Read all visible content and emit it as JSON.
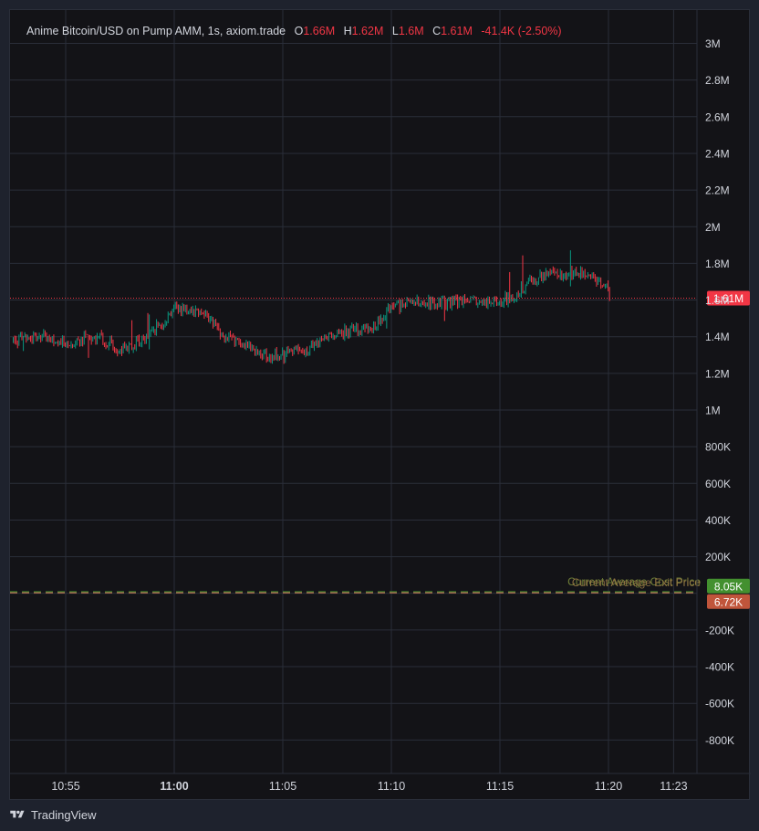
{
  "legend": {
    "symbol": "Anime Bitcoin/USD on Pump AMM, 1s, axiom.trade",
    "open_label": "O",
    "open": "1.66M",
    "high_label": "H",
    "high": "1.62M",
    "low_label": "L",
    "low": "1.6M",
    "close_label": "C",
    "close": "1.61M",
    "change": "-41.4K (-2.50%)"
  },
  "footer": {
    "brand": "TradingView"
  },
  "colors": {
    "background": "#131317",
    "grid": "#2a2e39",
    "text": "#d1d4dc",
    "up": "#089981",
    "down": "#f23645",
    "avg_green": "#43902f",
    "avg_red": "#c0553b"
  },
  "chart_data": {
    "type": "candlestick",
    "y_ticks": [
      "3M",
      "2.8M",
      "2.6M",
      "2.4M",
      "2.2M",
      "2M",
      "1.8M",
      "1.6M",
      "1.4M",
      "1.2M",
      "1M",
      "800K",
      "600K",
      "400K",
      "200K",
      "-200K",
      "-400K",
      "-600K",
      "-800K"
    ],
    "x_ticks": [
      {
        "label": "10:55",
        "time": "10:55",
        "bold": false
      },
      {
        "label": "11:00",
        "time": "11:00",
        "bold": true
      },
      {
        "label": "11:05",
        "time": "11:05",
        "bold": false
      },
      {
        "label": "11:10",
        "time": "11:10",
        "bold": false
      },
      {
        "label": "11:15",
        "time": "11:15",
        "bold": false
      },
      {
        "label": "11:20",
        "time": "11:20",
        "bold": false
      },
      {
        "label": "11:23",
        "time": "11:23",
        "bold": false
      }
    ],
    "ylim": [
      -850000,
      3050000
    ],
    "price_path": [
      [
        "10:52:35",
        1.38
      ],
      [
        "10:54:00",
        1.4
      ],
      [
        "10:55:00",
        1.37
      ],
      [
        "10:56:30",
        1.4
      ],
      [
        "10:57:30",
        1.33
      ],
      [
        "10:58:30",
        1.38
      ],
      [
        "10:59:30",
        1.48
      ],
      [
        "11:00:00",
        1.56
      ],
      [
        "11:00:40",
        1.55
      ],
      [
        "11:01:20",
        1.54
      ],
      [
        "11:02:00",
        1.43
      ],
      [
        "11:03:00",
        1.36
      ],
      [
        "11:04:00",
        1.3
      ],
      [
        "11:05:00",
        1.3
      ],
      [
        "11:06:00",
        1.33
      ],
      [
        "11:07:00",
        1.4
      ],
      [
        "11:08:00",
        1.43
      ],
      [
        "11:09:00",
        1.44
      ],
      [
        "11:10:00",
        1.56
      ],
      [
        "11:11:00",
        1.58
      ],
      [
        "11:12:00",
        1.58
      ],
      [
        "11:13:00",
        1.59
      ],
      [
        "11:14:00",
        1.59
      ],
      [
        "11:15:00",
        1.58
      ],
      [
        "11:16:00",
        1.66
      ],
      [
        "11:17:00",
        1.74
      ],
      [
        "11:18:00",
        1.75
      ],
      [
        "11:19:00",
        1.75
      ],
      [
        "11:19:50",
        1.68
      ],
      [
        "11:20:05",
        1.61
      ]
    ],
    "current_price": {
      "label": "1.61M",
      "value": 1610000
    },
    "avg_lines": [
      {
        "text": "Current Average Cost Price",
        "value": 8050,
        "label": "8.05K"
      },
      {
        "text": "Current Average Exit Price",
        "value": 6720,
        "label": "6.72K"
      }
    ]
  }
}
